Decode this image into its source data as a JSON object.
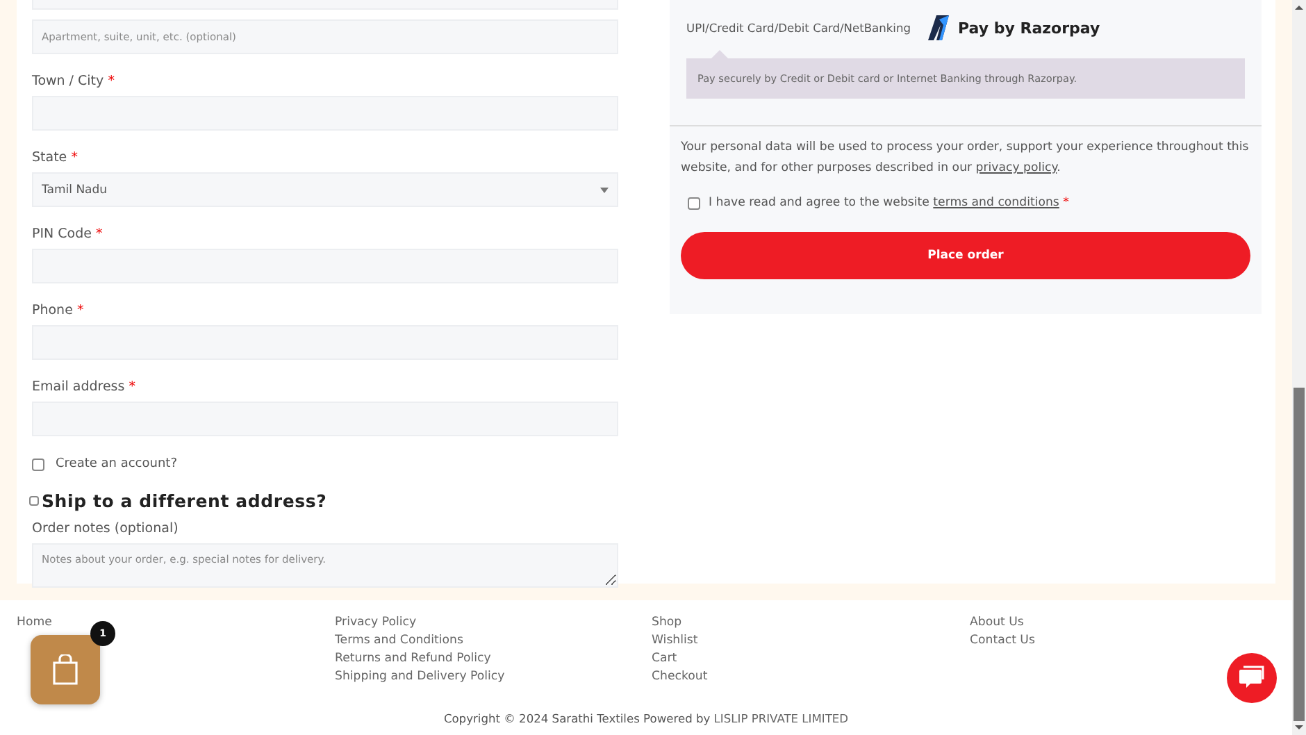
{
  "billing_fields": [
    {
      "kind": "partial"
    },
    {
      "kind": "text",
      "placeholder": "Apartment, suite, unit, etc. (optional)"
    },
    {
      "kind": "text",
      "label": "Town / City",
      "required_mark": "*"
    },
    {
      "kind": "select",
      "label": "State",
      "required_mark": "*",
      "value": "Tamil Nadu"
    },
    {
      "kind": "text",
      "label": "PIN Code",
      "required_mark": "*"
    },
    {
      "kind": "text",
      "label": "Phone",
      "required_mark": "*"
    },
    {
      "kind": "text",
      "label": "Email address",
      "required_mark": "*"
    }
  ],
  "create_account": {
    "label": "Create an account?",
    "checked": false
  },
  "ship_different": {
    "label": "Ship to a different address?",
    "checked": false
  },
  "order_notes": {
    "label": "Order notes (optional)",
    "placeholder": "Notes about your order, e.g. special notes for delivery."
  },
  "payment": {
    "method_label": "UPI/Credit Card/Debit Card/NetBanking",
    "logo_text": "Pay by Razorpay",
    "description": "Pay securely by Credit or Debit card or Internet Banking through Razorpay."
  },
  "privacy": {
    "text": "Your personal data will be used to process your order, support your experience throughout this website, and for other purposes described in our",
    "link": "privacy policy",
    "end": "."
  },
  "terms": {
    "text": "I have read and agree to the website",
    "link": "terms and conditions",
    "required_mark": "*",
    "checked": false
  },
  "place_order": "Place order",
  "footer_columns": [
    {
      "links": [
        "Home"
      ]
    },
    {
      "links": [
        "Privacy Policy",
        "Terms and Conditions",
        "Returns and Refund Policy",
        "Shipping and Delivery Policy"
      ]
    },
    {
      "links": [
        "Shop",
        "Wishlist",
        "Cart",
        "Checkout"
      ]
    },
    {
      "links": [
        "About Us",
        "Contact Us"
      ]
    }
  ],
  "copyright": {
    "text": "Copyright © 2024 Sarathi Textiles Powered by",
    "link": "LISLIP PRIVATE LIMITED"
  },
  "cart_badge": "1"
}
